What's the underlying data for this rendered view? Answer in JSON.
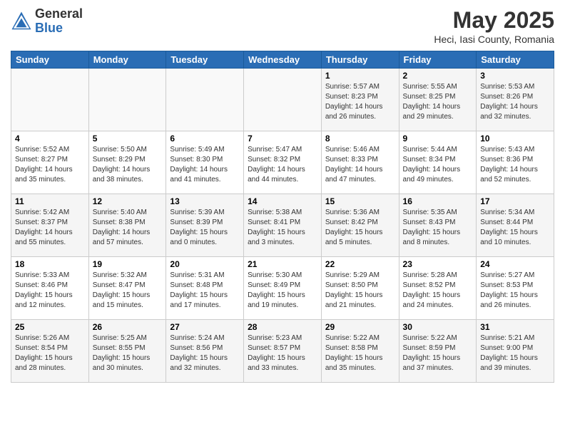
{
  "header": {
    "logo_general": "General",
    "logo_blue": "Blue",
    "month_year": "May 2025",
    "location": "Heci, Iasi County, Romania"
  },
  "weekdays": [
    "Sunday",
    "Monday",
    "Tuesday",
    "Wednesday",
    "Thursday",
    "Friday",
    "Saturday"
  ],
  "weeks": [
    [
      {
        "day": "",
        "info": ""
      },
      {
        "day": "",
        "info": ""
      },
      {
        "day": "",
        "info": ""
      },
      {
        "day": "",
        "info": ""
      },
      {
        "day": "1",
        "info": "Sunrise: 5:57 AM\nSunset: 8:23 PM\nDaylight: 14 hours\nand 26 minutes."
      },
      {
        "day": "2",
        "info": "Sunrise: 5:55 AM\nSunset: 8:25 PM\nDaylight: 14 hours\nand 29 minutes."
      },
      {
        "day": "3",
        "info": "Sunrise: 5:53 AM\nSunset: 8:26 PM\nDaylight: 14 hours\nand 32 minutes."
      }
    ],
    [
      {
        "day": "4",
        "info": "Sunrise: 5:52 AM\nSunset: 8:27 PM\nDaylight: 14 hours\nand 35 minutes."
      },
      {
        "day": "5",
        "info": "Sunrise: 5:50 AM\nSunset: 8:29 PM\nDaylight: 14 hours\nand 38 minutes."
      },
      {
        "day": "6",
        "info": "Sunrise: 5:49 AM\nSunset: 8:30 PM\nDaylight: 14 hours\nand 41 minutes."
      },
      {
        "day": "7",
        "info": "Sunrise: 5:47 AM\nSunset: 8:32 PM\nDaylight: 14 hours\nand 44 minutes."
      },
      {
        "day": "8",
        "info": "Sunrise: 5:46 AM\nSunset: 8:33 PM\nDaylight: 14 hours\nand 47 minutes."
      },
      {
        "day": "9",
        "info": "Sunrise: 5:44 AM\nSunset: 8:34 PM\nDaylight: 14 hours\nand 49 minutes."
      },
      {
        "day": "10",
        "info": "Sunrise: 5:43 AM\nSunset: 8:36 PM\nDaylight: 14 hours\nand 52 minutes."
      }
    ],
    [
      {
        "day": "11",
        "info": "Sunrise: 5:42 AM\nSunset: 8:37 PM\nDaylight: 14 hours\nand 55 minutes."
      },
      {
        "day": "12",
        "info": "Sunrise: 5:40 AM\nSunset: 8:38 PM\nDaylight: 14 hours\nand 57 minutes."
      },
      {
        "day": "13",
        "info": "Sunrise: 5:39 AM\nSunset: 8:39 PM\nDaylight: 15 hours\nand 0 minutes."
      },
      {
        "day": "14",
        "info": "Sunrise: 5:38 AM\nSunset: 8:41 PM\nDaylight: 15 hours\nand 3 minutes."
      },
      {
        "day": "15",
        "info": "Sunrise: 5:36 AM\nSunset: 8:42 PM\nDaylight: 15 hours\nand 5 minutes."
      },
      {
        "day": "16",
        "info": "Sunrise: 5:35 AM\nSunset: 8:43 PM\nDaylight: 15 hours\nand 8 minutes."
      },
      {
        "day": "17",
        "info": "Sunrise: 5:34 AM\nSunset: 8:44 PM\nDaylight: 15 hours\nand 10 minutes."
      }
    ],
    [
      {
        "day": "18",
        "info": "Sunrise: 5:33 AM\nSunset: 8:46 PM\nDaylight: 15 hours\nand 12 minutes."
      },
      {
        "day": "19",
        "info": "Sunrise: 5:32 AM\nSunset: 8:47 PM\nDaylight: 15 hours\nand 15 minutes."
      },
      {
        "day": "20",
        "info": "Sunrise: 5:31 AM\nSunset: 8:48 PM\nDaylight: 15 hours\nand 17 minutes."
      },
      {
        "day": "21",
        "info": "Sunrise: 5:30 AM\nSunset: 8:49 PM\nDaylight: 15 hours\nand 19 minutes."
      },
      {
        "day": "22",
        "info": "Sunrise: 5:29 AM\nSunset: 8:50 PM\nDaylight: 15 hours\nand 21 minutes."
      },
      {
        "day": "23",
        "info": "Sunrise: 5:28 AM\nSunset: 8:52 PM\nDaylight: 15 hours\nand 24 minutes."
      },
      {
        "day": "24",
        "info": "Sunrise: 5:27 AM\nSunset: 8:53 PM\nDaylight: 15 hours\nand 26 minutes."
      }
    ],
    [
      {
        "day": "25",
        "info": "Sunrise: 5:26 AM\nSunset: 8:54 PM\nDaylight: 15 hours\nand 28 minutes."
      },
      {
        "day": "26",
        "info": "Sunrise: 5:25 AM\nSunset: 8:55 PM\nDaylight: 15 hours\nand 30 minutes."
      },
      {
        "day": "27",
        "info": "Sunrise: 5:24 AM\nSunset: 8:56 PM\nDaylight: 15 hours\nand 32 minutes."
      },
      {
        "day": "28",
        "info": "Sunrise: 5:23 AM\nSunset: 8:57 PM\nDaylight: 15 hours\nand 33 minutes."
      },
      {
        "day": "29",
        "info": "Sunrise: 5:22 AM\nSunset: 8:58 PM\nDaylight: 15 hours\nand 35 minutes."
      },
      {
        "day": "30",
        "info": "Sunrise: 5:22 AM\nSunset: 8:59 PM\nDaylight: 15 hours\nand 37 minutes."
      },
      {
        "day": "31",
        "info": "Sunrise: 5:21 AM\nSunset: 9:00 PM\nDaylight: 15 hours\nand 39 minutes."
      }
    ]
  ]
}
